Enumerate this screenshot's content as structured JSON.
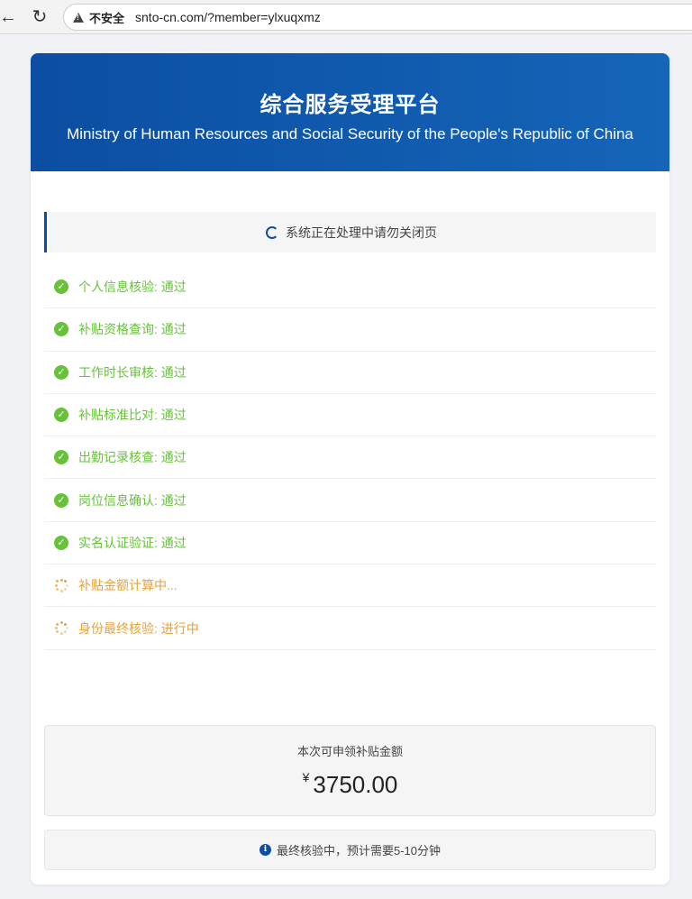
{
  "browser": {
    "security_label": "不安全",
    "url": "snto-cn.com/?member=ylxuqxmz",
    "icons": [
      "back-icon",
      "reload-icon",
      "warning-icon"
    ]
  },
  "header": {
    "title": "综合服务受理平台",
    "subtitle": "Ministry of Human Resources and Social Security of the People's Republic of China"
  },
  "status": {
    "text": "系统正在处理中请勿关闭页",
    "icon": "spinner-icon"
  },
  "checks": [
    {
      "label": "个人信息核验: 通过",
      "state": "done"
    },
    {
      "label": "补贴资格查询: 通过",
      "state": "done"
    },
    {
      "label": "工作时长审核: 通过",
      "state": "done"
    },
    {
      "label": "补贴标准比对: 通过",
      "state": "done"
    },
    {
      "label": "出勤记录核查: 通过",
      "state": "done"
    },
    {
      "label": "岗位信息确认: 通过",
      "state": "done"
    },
    {
      "label": "实名认证验证: 通过",
      "state": "done"
    },
    {
      "label": "补贴金额计算中...",
      "state": "pending"
    },
    {
      "label": "身份最终核验: 进行中",
      "state": "pending"
    }
  ],
  "amount": {
    "label": "本次可申领补贴金额",
    "currency": "¥",
    "value": "3750.00"
  },
  "note": {
    "text": "最终核验中，预计需要5-10分钟",
    "icon": "info-icon"
  },
  "colors": {
    "brand": "#0b4ea2",
    "success": "#67c23a",
    "pending": "#e6a23c"
  }
}
